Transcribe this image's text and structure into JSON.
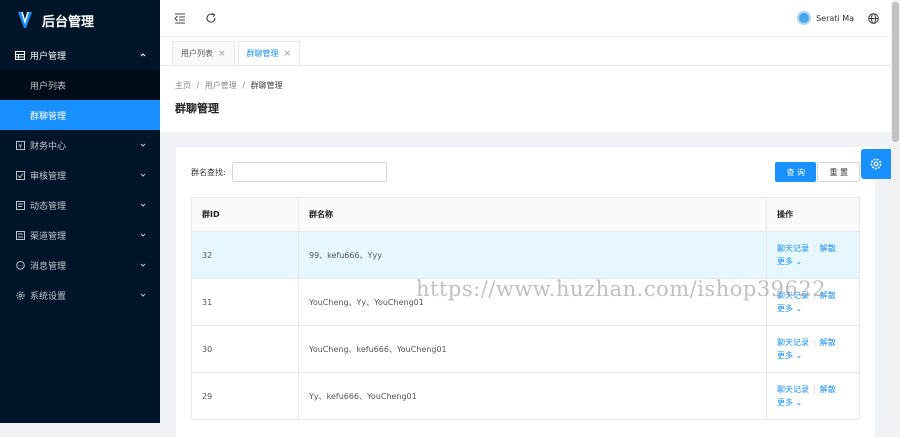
{
  "app": {
    "title": "后台管理"
  },
  "sidebar": {
    "menus": [
      {
        "label": "用户管理",
        "icon": "table-icon",
        "expanded": true
      },
      {
        "label": "财务中心",
        "icon": "finance-icon"
      },
      {
        "label": "审核管理",
        "icon": "check-square-icon"
      },
      {
        "label": "动态管理",
        "icon": "file-icon"
      },
      {
        "label": "渠道管理",
        "icon": "channel-icon"
      },
      {
        "label": "消息管理",
        "icon": "message-icon"
      },
      {
        "label": "系统设置",
        "icon": "setting-icon"
      }
    ],
    "submenu": [
      {
        "label": "用户列表"
      },
      {
        "label": "群聊管理",
        "active": true
      }
    ]
  },
  "header": {
    "username": "Serati Ma"
  },
  "tabs": [
    {
      "label": "用户列表",
      "close": "×"
    },
    {
      "label": "群聊管理",
      "close": "×",
      "active": true
    }
  ],
  "breadcrumb": {
    "home": "主页",
    "sep": "/",
    "parent": "用户管理",
    "current": "群聊管理"
  },
  "page": {
    "title": "群聊管理"
  },
  "search": {
    "label": "群名查找:",
    "value": "",
    "query_button": "查 询",
    "reset_button": "重 置"
  },
  "table": {
    "columns": [
      "群ID",
      "群名称",
      "操作"
    ],
    "rows": [
      {
        "id": "32",
        "name": "99、kefu666、Yyy",
        "highlight": true
      },
      {
        "id": "31",
        "name": "YouCheng、Yy、YouCheng01"
      },
      {
        "id": "30",
        "name": "YouCheng、kefu666、YouCheng01"
      },
      {
        "id": "29",
        "name": "Yy、kefu666、YouCheng01"
      }
    ],
    "actions": {
      "chat_log": "聊天记录",
      "dissolve": "解散",
      "more": "更多 ⌄",
      "sep": "|"
    }
  },
  "watermark": "https://www.huzhan.com/ishop39622",
  "colors": {
    "primary": "#1890ff",
    "sidebar": "#001529",
    "submenu": "#000c17",
    "highlight_row": "#e6f7ff"
  }
}
